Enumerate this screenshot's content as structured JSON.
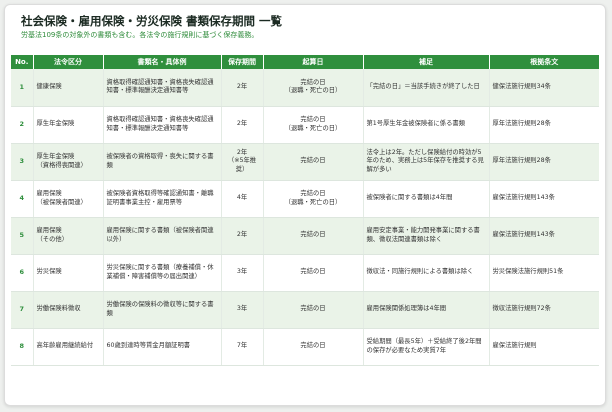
{
  "title": "社会保険・雇用保険・労災保険 書類保存期間 一覧",
  "subtitle": "労基法109条の対象外の書類も含む。各法令の施行規則に基づく保存義務。",
  "columns": [
    "No.",
    "法令区分",
    "書類名・具体例",
    "保存期間",
    "起算日",
    "補足",
    "根拠条文"
  ],
  "rows": [
    {
      "no": "1",
      "category": "健康保険",
      "document": "資格取得確認通知書・資格喪失確認通知書・標準報酬決定通知書等",
      "period": "2年",
      "start": "完結の日\n（退職・死亡の日）",
      "note": "「完結の日」＝当該手続きが終了した日",
      "basis": "健保法施行規則34条"
    },
    {
      "no": "2",
      "category": "厚生年金保険",
      "document": "資格取得確認通知書・資格喪失確認通知書・標準報酬決定通知書等",
      "period": "2年",
      "start": "完結の日\n（退職・死亡の日）",
      "note": "第1号厚生年金被保険者に係る書類",
      "basis": "厚年法施行規則28条"
    },
    {
      "no": "3",
      "category": "厚生年金保険\n（資格得喪関連）",
      "document": "被保険者の資格取得・喪失に関する書類",
      "period": "2年\n（※5年推奨）",
      "start": "完結の日",
      "note": "法令上は2年。ただし保険給付の時効が5年のため、実務上は5年保存を推奨する見解が多い",
      "basis": "厚年法施行規則28条"
    },
    {
      "no": "4",
      "category": "雇用保険\n（被保険者関連）",
      "document": "被保険者資格取得等確認通知書・離職証明書事業主控・雇用票等",
      "period": "4年",
      "start": "完結の日\n（退職・死亡の日）",
      "note": "被保険者に関する書類は4年間",
      "basis": "雇保法施行規則143条"
    },
    {
      "no": "5",
      "category": "雇用保険\n（その他）",
      "document": "雇用保険に関する書類（被保険者関連以外）",
      "period": "2年",
      "start": "完結の日",
      "note": "雇用安定事業・能力開発事業に関する書類、徴収法関連書類は除く",
      "basis": "雇保法施行規則143条"
    },
    {
      "no": "6",
      "category": "労災保険",
      "document": "労災保険に関する書類（療養補償・休業補償・障害補償等の届出関連）",
      "period": "3年",
      "start": "完結の日",
      "note": "徴収法・同施行規則による書類は除く",
      "basis": "労災保険法施行規則51条"
    },
    {
      "no": "7",
      "category": "労働保険料徴収",
      "document": "労働保険の保険料の徴収等に関する書類",
      "period": "3年",
      "start": "完結の日",
      "note": "雇用保険関係処理簿は4年間",
      "basis": "徴収法施行規則72条"
    },
    {
      "no": "8",
      "category": "高年齢雇用継続給付",
      "document": "60歳到達時等賃金月額証明書",
      "period": "7年",
      "start": "完結の日",
      "note": "受給期間（最長5年）＋受給終了後2年間の保存が必要なため実質7年",
      "basis": "雇保法施行規則"
    }
  ]
}
